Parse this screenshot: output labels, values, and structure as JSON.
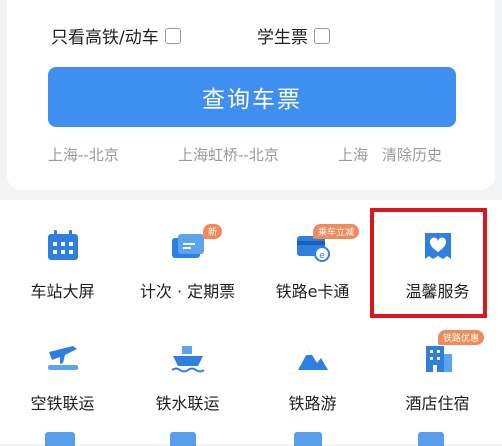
{
  "options": {
    "high_speed_label": "只看高铁/动车",
    "student_label": "学生票"
  },
  "query_button": "查询车票",
  "history": [
    "上海--北京",
    "上海虹桥--北京",
    "上海"
  ],
  "clear_history": "清除历史",
  "services": [
    {
      "label": "车站大屏",
      "icon": "calendar-grid-icon"
    },
    {
      "label": "计次 · 定期票",
      "icon": "ticket-card-icon",
      "badge": "新"
    },
    {
      "label": "铁路e卡通",
      "icon": "e-card-icon",
      "badge": "乘车立减"
    },
    {
      "label": "温馨服务",
      "icon": "heart-bag-icon"
    },
    {
      "label": "空铁联运",
      "icon": "plane-train-icon"
    },
    {
      "label": "铁水联运",
      "icon": "ship-icon"
    },
    {
      "label": "铁路游",
      "icon": "mountain-icon"
    },
    {
      "label": "酒店住宿",
      "icon": "hotel-building-icon",
      "badge": "铁路优惠"
    }
  ],
  "colors": {
    "accent": "#3f8ff0",
    "highlight": "#d7191e",
    "badge": "#f08a5a"
  }
}
